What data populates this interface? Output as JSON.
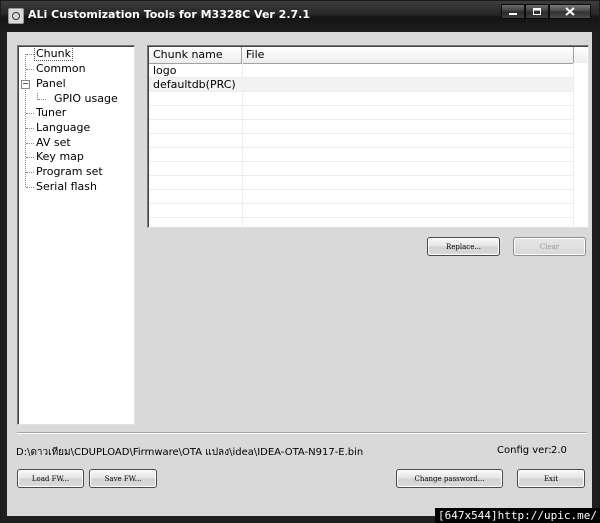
{
  "window": {
    "title": "ALi Customization Tools for M3328C  Ver 2.7.1"
  },
  "tree": {
    "items": [
      {
        "label": "Chunk",
        "level": 1,
        "selected": true
      },
      {
        "label": "Common",
        "level": 1
      },
      {
        "label": "Panel",
        "level": 1,
        "expander": "−"
      },
      {
        "label": "GPIO usage",
        "level": 2
      },
      {
        "label": "Tuner",
        "level": 1
      },
      {
        "label": "Language",
        "level": 1
      },
      {
        "label": "AV set",
        "level": 1
      },
      {
        "label": "Key map",
        "level": 1
      },
      {
        "label": "Program set",
        "level": 1
      },
      {
        "label": "Serial flash",
        "level": 1
      }
    ]
  },
  "chunk_list": {
    "columns": [
      "Chunk name",
      "File"
    ],
    "rows": [
      {
        "chunk_name": "logo",
        "file": ""
      },
      {
        "chunk_name": "defaultdb(PRC)",
        "file": ""
      }
    ]
  },
  "buttons": {
    "replace": "Replace...",
    "clear": "Clear",
    "load_fw": "Load FW...",
    "save_fw": "Save FW...",
    "change_password": "Change password...",
    "exit": "Exit"
  },
  "status": {
    "path": "D:\\ดาวเทียม\\CDUPLOAD\\Firmware\\OTA แปลง\\idea\\IDEA-OTA-N917-E.bin",
    "config_label": "Config ver:",
    "config_value": "2.0"
  },
  "overlay": {
    "stamp": "[647x544]http://upic.me/"
  }
}
